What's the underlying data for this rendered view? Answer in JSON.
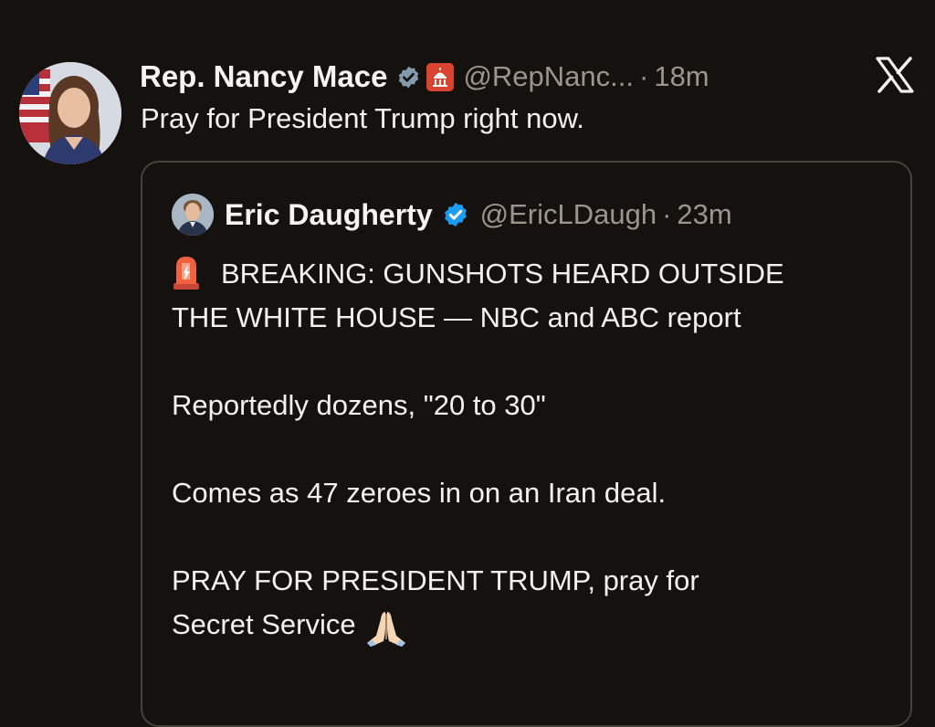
{
  "post": {
    "author_name": "Rep. Nancy Mace",
    "handle": "@RepNanc...",
    "separator": "·",
    "time": "18m",
    "text": "Pray for President Trump right now.",
    "icons": {
      "avatar": "avatar-photo",
      "verified": "verified-badge-icon",
      "government": "government-badge-icon",
      "platform": "x-logo-icon"
    }
  },
  "quote": {
    "author_name": "Eric Daugherty",
    "handle": "@EricLDaugh",
    "separator": "·",
    "time": "23m",
    "lines": {
      "l1": "BREAKING: GUNSHOTS HEARD OUTSIDE",
      "l2": "THE WHITE HOUSE — NBC and ABC report",
      "l3": "Reportedly dozens, \"20 to 30\"",
      "l4": "Comes as 47 zeroes in on an Iran deal.",
      "l5": "PRAY FOR PRESIDENT TRUMP, pray for",
      "l6": "Secret Service"
    },
    "icons": {
      "siren": "siren-emoji-icon",
      "pray": "praying-hands-emoji-icon"
    }
  },
  "colors": {
    "background": "#14110e",
    "text": "#f4f2ee",
    "muted": "#9a958f",
    "verified_blue": "#1d9bf0",
    "verified_gray": "#829aab",
    "card_border": "#45413c"
  }
}
